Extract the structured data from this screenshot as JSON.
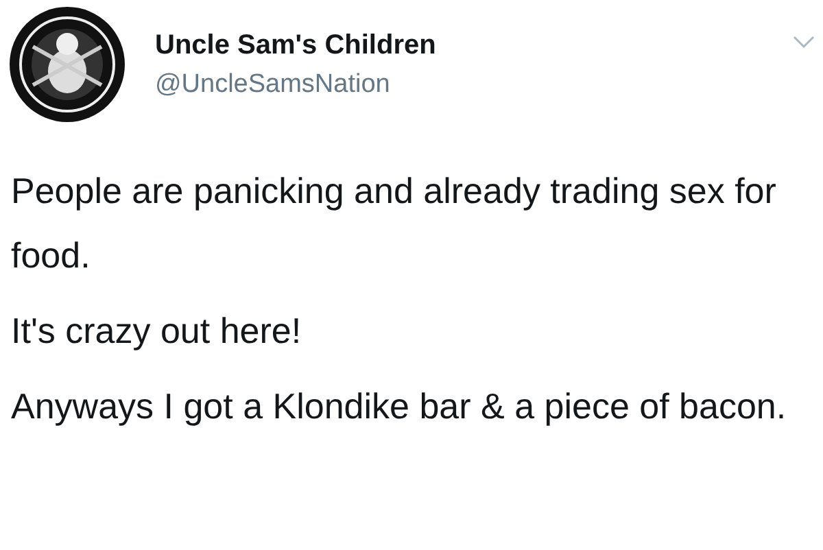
{
  "author": {
    "name": "Uncle Sam's Children",
    "handle": "@UncleSamsNation"
  },
  "paragraphs": [
    "People are panicking and already trading sex for food.",
    "It's crazy out here!",
    "Anyways I got a Klondike bar & a piece of bacon."
  ]
}
